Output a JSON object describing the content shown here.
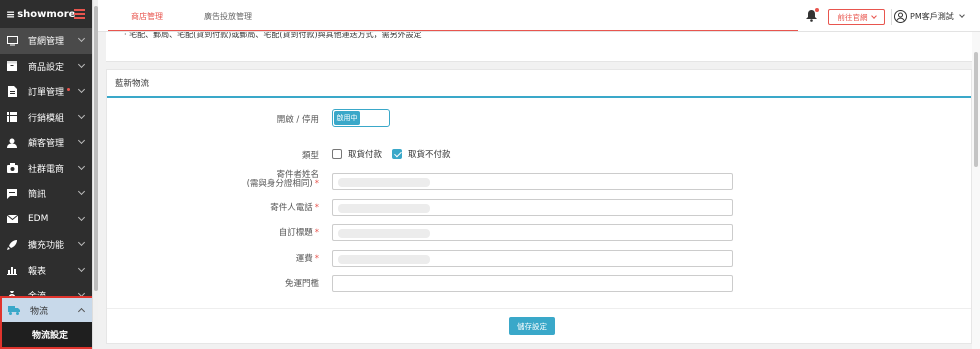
{
  "sidebar": {
    "logo": "showmore",
    "items": [
      {
        "label": "官網管理",
        "icon": "monitor-icon",
        "has_chevron": true
      },
      {
        "label": "商品設定",
        "icon": "box-icon",
        "has_chevron": true
      },
      {
        "label": "訂單管理",
        "icon": "document-icon",
        "has_chevron": true,
        "badge_dot": true
      },
      {
        "label": "行銷模組",
        "icon": "grid-icon",
        "has_chevron": true
      },
      {
        "label": "顧客管理",
        "icon": "person-icon",
        "has_chevron": true
      },
      {
        "label": "社群電商",
        "icon": "camera-icon",
        "has_chevron": true
      },
      {
        "label": "簡訊",
        "icon": "chat-icon",
        "has_chevron": true
      },
      {
        "label": "EDM",
        "icon": "mail-icon",
        "has_chevron": true
      },
      {
        "label": "擴充功能",
        "icon": "rocket-icon",
        "has_chevron": true
      },
      {
        "label": "報表",
        "icon": "bar-chart-icon",
        "has_chevron": true
      },
      {
        "label": "金流",
        "icon": "money-bag-icon",
        "has_chevron": true
      }
    ],
    "active_item": {
      "label": "物流",
      "icon": "truck-icon"
    },
    "submenu": {
      "label": "物流設定"
    }
  },
  "topbar": {
    "tabs": [
      {
        "label": "商店管理",
        "active": true
      },
      {
        "label": "廣告投放管理",
        "active": false
      }
    ],
    "store_button": "前往官網",
    "user_name": "PM客戶測試"
  },
  "notice": {
    "text": "‧ 宅配、郵局、宅配(貨到付款)或郵局、宅配(貨到付款)與其他運送方式，需另外設定"
  },
  "form": {
    "section_title": "藍新物流",
    "enable_label": "開啟 / 停用",
    "toggle_on_label": "啟用中",
    "type_label": "類型",
    "type_options": [
      {
        "label": "取貨付款",
        "checked": false
      },
      {
        "label": "取貨不付款",
        "checked": true
      }
    ],
    "sender_name_label_line1": "寄件者姓名",
    "sender_name_label_line2": "(需與身分證相同)",
    "sender_phone_label": "寄件人電話",
    "custom_title_label": "自訂標題",
    "shipping_fee_label": "運費",
    "free_shipping_label": "免運門檻",
    "required_mark": "*",
    "save_button": "儲存設定"
  },
  "colors": {
    "accent": "#e8554e",
    "primary": "#3aa8c9",
    "sidebar_bg": "#2e2e2e",
    "highlight_border": "#e0342d"
  }
}
